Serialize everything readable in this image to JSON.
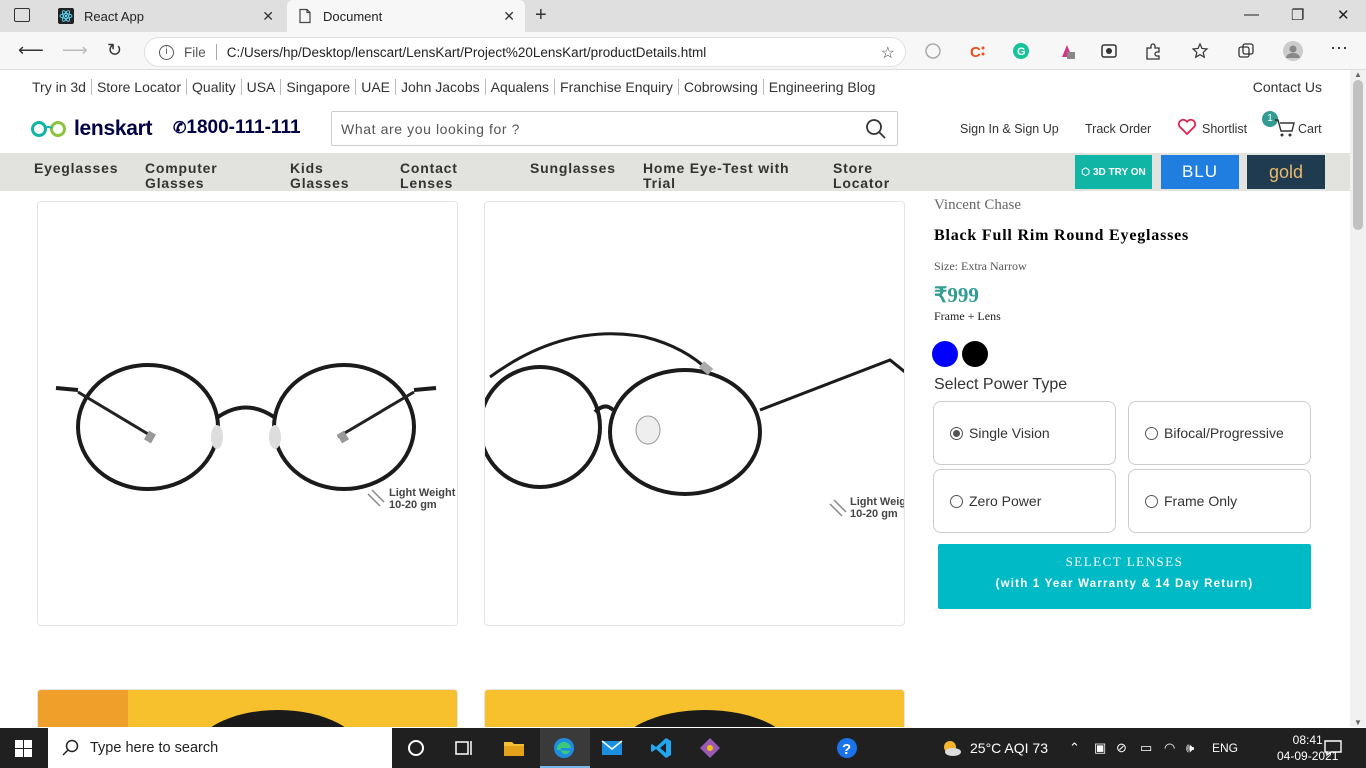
{
  "browser": {
    "tabs": [
      {
        "title": "React App",
        "active": false,
        "icon": "react-icon"
      },
      {
        "title": "Document",
        "active": true,
        "icon": "document-icon"
      }
    ],
    "address": {
      "protocol_label": "File",
      "url": "C:/Users/hp/Desktop/lenscart/LensKart/Project%20LensKart/productDetails.html"
    }
  },
  "site": {
    "top_links": [
      "Try in 3d",
      "Store Locator",
      "Quality",
      "USA",
      "Singapore",
      "UAE",
      "John Jacobs",
      "Aqualens",
      "Franchise Enquiry",
      "Cobrowsing",
      "Engineering Blog"
    ],
    "contact_us": "Contact Us",
    "logo_text": "lenskart",
    "phone": "1800-111-111",
    "search_placeholder": "What are you looking for ?",
    "header_links": {
      "sign_in": "Sign In & Sign Up",
      "track_order": "Track Order",
      "shortlist": "Shortlist",
      "cart": "Cart",
      "cart_count": "1"
    },
    "nav": [
      {
        "line1": "Eyeglasses",
        "line2": ""
      },
      {
        "line1": "Computer",
        "line2": "Glasses"
      },
      {
        "line1": "Kids",
        "line2": "Glasses"
      },
      {
        "line1": "Contact",
        "line2": "Lenses"
      },
      {
        "line1": "Sunglasses",
        "line2": ""
      },
      {
        "line1": "Home Eye-Test with",
        "line2": "Trial"
      },
      {
        "line1": "Store",
        "line2": "Locator"
      }
    ],
    "promo": {
      "try_3d": "3D TRY ON",
      "blu": "BLU",
      "gold": "gold"
    },
    "colors": {
      "accent": "#329c92",
      "nav_bg": "#e2e2de",
      "cta": "#00bac6"
    }
  },
  "product": {
    "weight_label_1": "Light Weight",
    "weight_label_2": "10-20 gm",
    "weight_label_cut_1": "Light Weig",
    "brand": "Vincent Chase",
    "name": "Black Full Rim Round Eyeglasses",
    "size": "Size: Extra Narrow",
    "price": "₹999",
    "price_note": "Frame + Lens",
    "swatches": [
      "#0000ff",
      "#000000"
    ],
    "select_power_title": "Select Power Type",
    "power_options": [
      {
        "label": "Single Vision",
        "checked": true
      },
      {
        "label": "Bifocal/Progressive",
        "checked": false
      },
      {
        "label": "Zero Power",
        "checked": false
      },
      {
        "label": "Frame Only",
        "checked": false
      }
    ],
    "cta_line1": "SELECT LENSES",
    "cta_line2": "(with 1 Year Warranty & 14 Day Return)"
  },
  "taskbar": {
    "search_placeholder": "Type here to search",
    "weather": "25°C  AQI 73",
    "lang": "ENG",
    "time": "08:41",
    "date": "04-09-2021"
  }
}
